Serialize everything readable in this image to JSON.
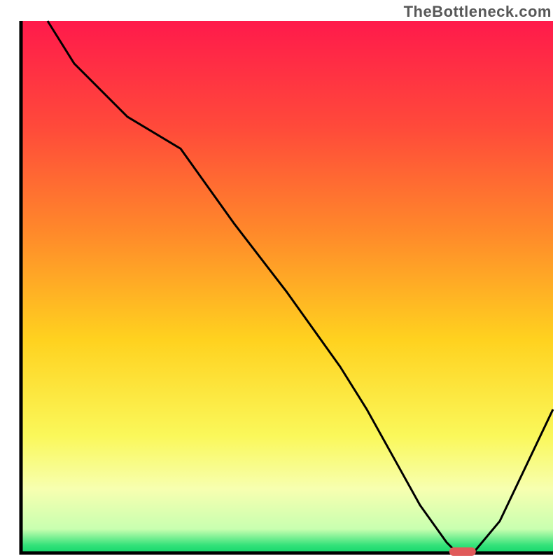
{
  "watermark": "TheBottleneck.com",
  "chart_data": {
    "type": "line",
    "title": "",
    "xlabel": "",
    "ylabel": "",
    "xlim": [
      0,
      100
    ],
    "ylim": [
      0,
      100
    ],
    "grid": false,
    "legend": false,
    "gradient_stops": [
      {
        "offset": 0.0,
        "color": "#ff1a4b"
      },
      {
        "offset": 0.2,
        "color": "#ff4a3a"
      },
      {
        "offset": 0.4,
        "color": "#ff8a2a"
      },
      {
        "offset": 0.6,
        "color": "#ffd21f"
      },
      {
        "offset": 0.78,
        "color": "#faf85a"
      },
      {
        "offset": 0.88,
        "color": "#f7ffb0"
      },
      {
        "offset": 0.955,
        "color": "#c8ffb0"
      },
      {
        "offset": 0.985,
        "color": "#35e27a"
      },
      {
        "offset": 1.0,
        "color": "#12d66b"
      }
    ],
    "series": [
      {
        "name": "bottleneck-curve",
        "x": [
          5,
          10,
          20,
          30,
          40,
          50,
          60,
          65,
          70,
          75,
          80,
          82,
          85,
          90,
          100
        ],
        "y": [
          100,
          92,
          82,
          76,
          62,
          49,
          35,
          27,
          18,
          9,
          2,
          0,
          0,
          6,
          27
        ]
      }
    ],
    "optimal_marker": {
      "x_start": 80.5,
      "x_end": 85.5,
      "y": 0,
      "color": "#e05a5a"
    },
    "axis_color": "#000000",
    "line_color": "#000000",
    "line_width": 3
  }
}
